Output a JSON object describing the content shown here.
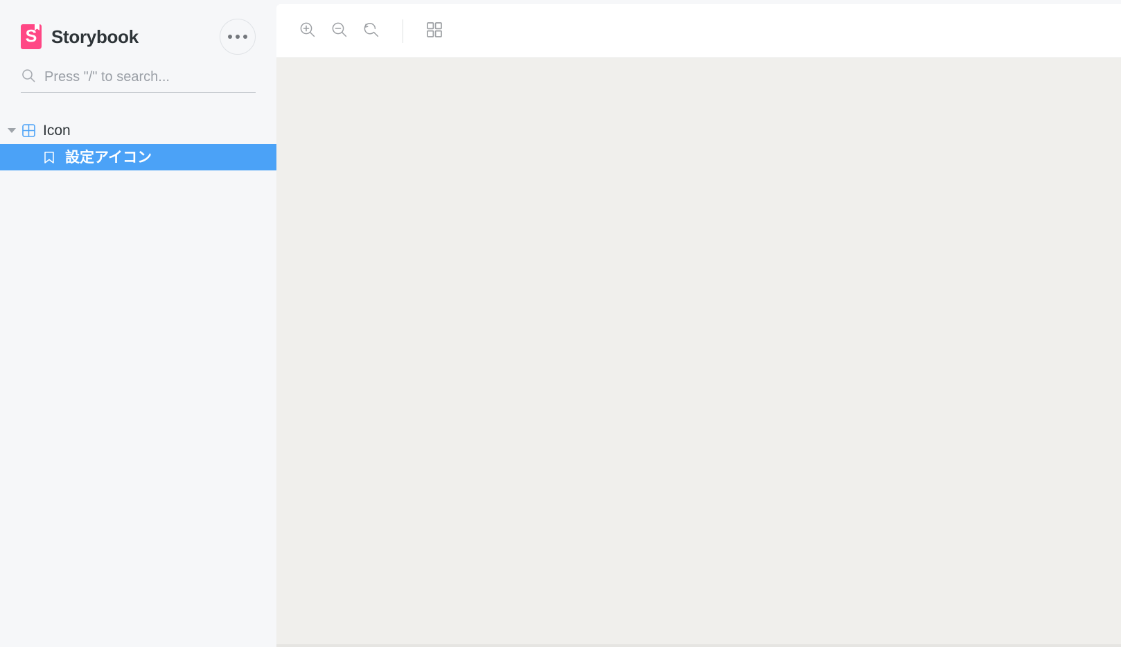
{
  "brand": {
    "title": "Storybook",
    "logo_icon": "storybook-logo-icon",
    "logo_color": "#ff4785",
    "menu_icon": "ellipsis-icon"
  },
  "search": {
    "placeholder": "Press \"/\" to search...",
    "value": "",
    "icon": "search-icon"
  },
  "sidebar": {
    "background": "#f6f7f9",
    "selected_color": "#4ba2f7",
    "tree": [
      {
        "label": "Icon",
        "type": "component",
        "icon": "component-grid-icon",
        "chevron": "chevron-down-icon",
        "expanded": true,
        "selected": false
      },
      {
        "label": "設定アイコン",
        "type": "story",
        "icon": "bookmark-icon",
        "selected": true
      }
    ]
  },
  "toolbar": {
    "zoom_in_label": "Zoom in",
    "zoom_out_label": "Zoom out",
    "zoom_reset_label": "Reset zoom",
    "grid_label": "Change background",
    "icons": {
      "zoom_in": "zoom-in-icon",
      "zoom_out": "zoom-out-icon",
      "zoom_reset": "zoom-reset-icon",
      "grid": "grid-icon"
    }
  },
  "canvas": {
    "background": "#f0efec",
    "content": ""
  }
}
